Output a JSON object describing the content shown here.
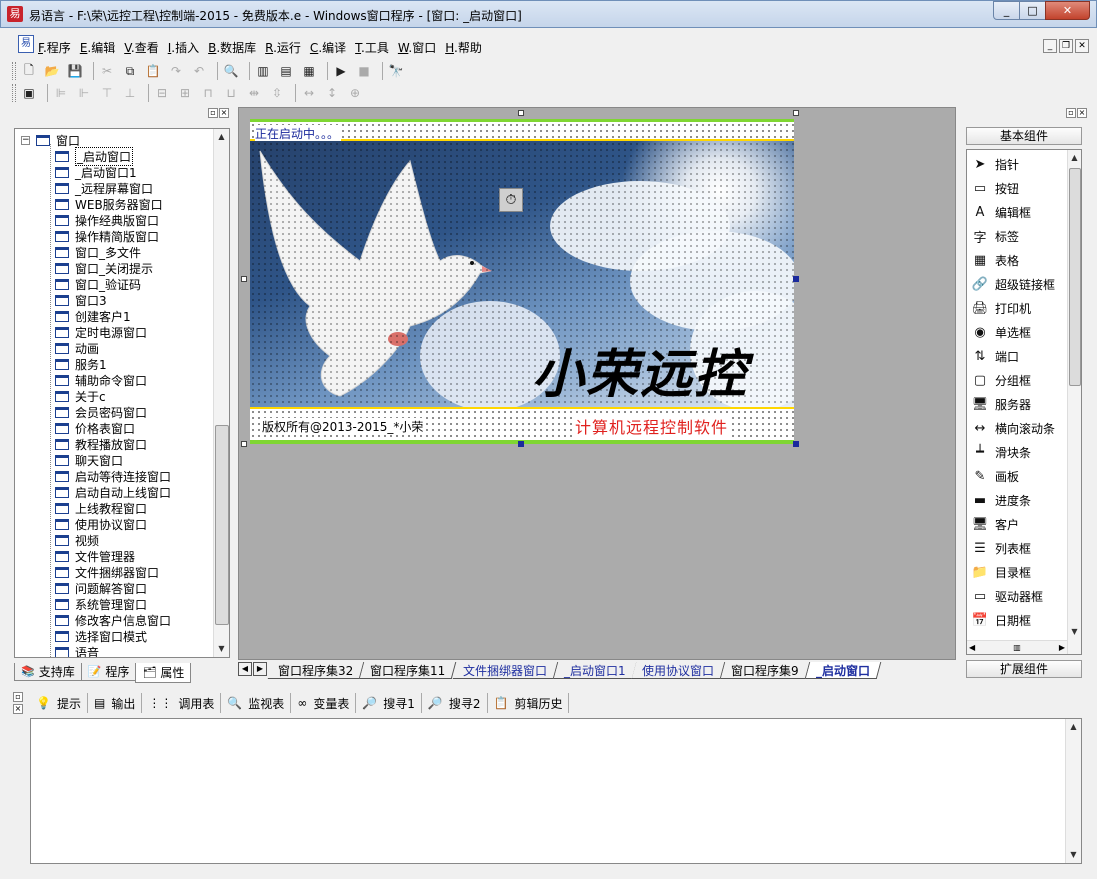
{
  "window": {
    "title": "易语言 - F:\\荣\\远控工程\\控制端-2015 - 免费版本.e - Windows窗口程序 - [窗口: _启动窗口]",
    "buttons": [
      "_",
      "□",
      "✕"
    ]
  },
  "menu": {
    "items": [
      {
        "key": "F",
        "label": ".程序"
      },
      {
        "key": "E",
        "label": ".编辑"
      },
      {
        "key": "V",
        "label": ".查看"
      },
      {
        "key": "I",
        "label": ".插入"
      },
      {
        "key": "B",
        "label": ".数据库"
      },
      {
        "key": "R",
        "label": ".运行"
      },
      {
        "key": "C",
        "label": ".编译"
      },
      {
        "key": "T",
        "label": ".工具"
      },
      {
        "key": "W",
        "label": ".窗口"
      },
      {
        "key": "H",
        "label": ".帮助"
      }
    ]
  },
  "tree": {
    "root": "窗口",
    "items": [
      "_启动窗口",
      "_启动窗口1",
      "_远程屏幕窗口",
      "WEB服务器窗口",
      "操作经典版窗口",
      "操作精简版窗口",
      "窗口_多文件",
      "窗口_关闭提示",
      "窗口_验证码",
      "窗口3",
      "创建客户1",
      "定时电源窗口",
      "动画",
      "服务1",
      "辅助命令窗口",
      "关于c",
      "会员密码窗口",
      "价格表窗口",
      "教程播放窗口",
      "聊天窗口",
      "启动等待连接窗口",
      "启动自动上线窗口",
      "上线教程窗口",
      "使用协议窗口",
      "视频",
      "文件管理器",
      "文件捆绑器窗口",
      "问题解答窗口",
      "系统管理窗口",
      "修改客户信息窗口",
      "选择窗口模式",
      "语音"
    ],
    "selected_index": 0
  },
  "left_tabs": [
    "支持库",
    "程序",
    "属性"
  ],
  "form": {
    "status_text": "正在启动中。。。",
    "brand": "小荣远控",
    "copyright": "版权所有@2013-2015_*小荣",
    "slogan": "计算机远程控制软件"
  },
  "doc_tabs": [
    {
      "label": "窗口程序集32",
      "blue": false,
      "active": false
    },
    {
      "label": "窗口程序集11",
      "blue": false,
      "active": false
    },
    {
      "label": "文件捆绑器窗口",
      "blue": true,
      "active": false
    },
    {
      "label": "_启动窗口1",
      "blue": true,
      "active": false
    },
    {
      "label": "使用协议窗口",
      "blue": true,
      "active": false
    },
    {
      "label": "窗口程序集9",
      "blue": false,
      "active": false
    },
    {
      "label": "_启动窗口",
      "blue": true,
      "active": true
    }
  ],
  "components": {
    "basic_label": "基本组件",
    "extended_label": "扩展组件",
    "items": [
      {
        "label": "指针",
        "icon": "pointer-icon",
        "glyph": "➤"
      },
      {
        "label": "按钮",
        "icon": "button-icon",
        "glyph": "▭"
      },
      {
        "label": "编辑框",
        "icon": "editbox-icon",
        "glyph": "A"
      },
      {
        "label": "标签",
        "icon": "label-icon",
        "glyph": "字"
      },
      {
        "label": "表格",
        "icon": "table-icon",
        "glyph": "▦"
      },
      {
        "label": "超级链接框",
        "icon": "hyperlink-icon",
        "glyph": "🔗"
      },
      {
        "label": "打印机",
        "icon": "printer-icon",
        "glyph": "🖨"
      },
      {
        "label": "单选框",
        "icon": "radio-icon",
        "glyph": "◉"
      },
      {
        "label": "端口",
        "icon": "port-icon",
        "glyph": "⇅"
      },
      {
        "label": "分组框",
        "icon": "groupbox-icon",
        "glyph": "▢"
      },
      {
        "label": "服务器",
        "icon": "server-icon",
        "glyph": "🖥"
      },
      {
        "label": "横向滚动条",
        "icon": "hscrollbar-icon",
        "glyph": "↔"
      },
      {
        "label": "滑块条",
        "icon": "slider-icon",
        "glyph": "┷"
      },
      {
        "label": "画板",
        "icon": "canvas-icon",
        "glyph": "✎"
      },
      {
        "label": "进度条",
        "icon": "progressbar-icon",
        "glyph": "▬"
      },
      {
        "label": "客户",
        "icon": "client-icon",
        "glyph": "🖥"
      },
      {
        "label": "列表框",
        "icon": "listbox-icon",
        "glyph": "☰"
      },
      {
        "label": "目录框",
        "icon": "dirbox-icon",
        "glyph": "📁"
      },
      {
        "label": "驱动器框",
        "icon": "drivebox-icon",
        "glyph": "▭"
      },
      {
        "label": "日期框",
        "icon": "datebox-icon",
        "glyph": "📅"
      }
    ]
  },
  "output_tabs": [
    {
      "label": "提示",
      "icon": "hint-icon",
      "glyph": "💡"
    },
    {
      "label": "输出",
      "icon": "output-icon",
      "glyph": "▤"
    },
    {
      "label": "调用表",
      "icon": "callstack-icon",
      "glyph": "⋮⋮"
    },
    {
      "label": "监视表",
      "icon": "watch-icon",
      "glyph": "🔍"
    },
    {
      "label": "变量表",
      "icon": "variables-icon",
      "glyph": "∞"
    },
    {
      "label": "搜寻1",
      "icon": "search1-icon",
      "glyph": "🔎"
    },
    {
      "label": "搜寻2",
      "icon": "search2-icon",
      "glyph": "🔎"
    },
    {
      "label": "剪辑历史",
      "icon": "clipboard-icon",
      "glyph": "📋"
    }
  ],
  "colors": {
    "accent_blue": "#1f2fa0",
    "green_strip": "#7fd632",
    "yellow_strip": "#ffd700",
    "slogan_red": "#e0211e"
  }
}
